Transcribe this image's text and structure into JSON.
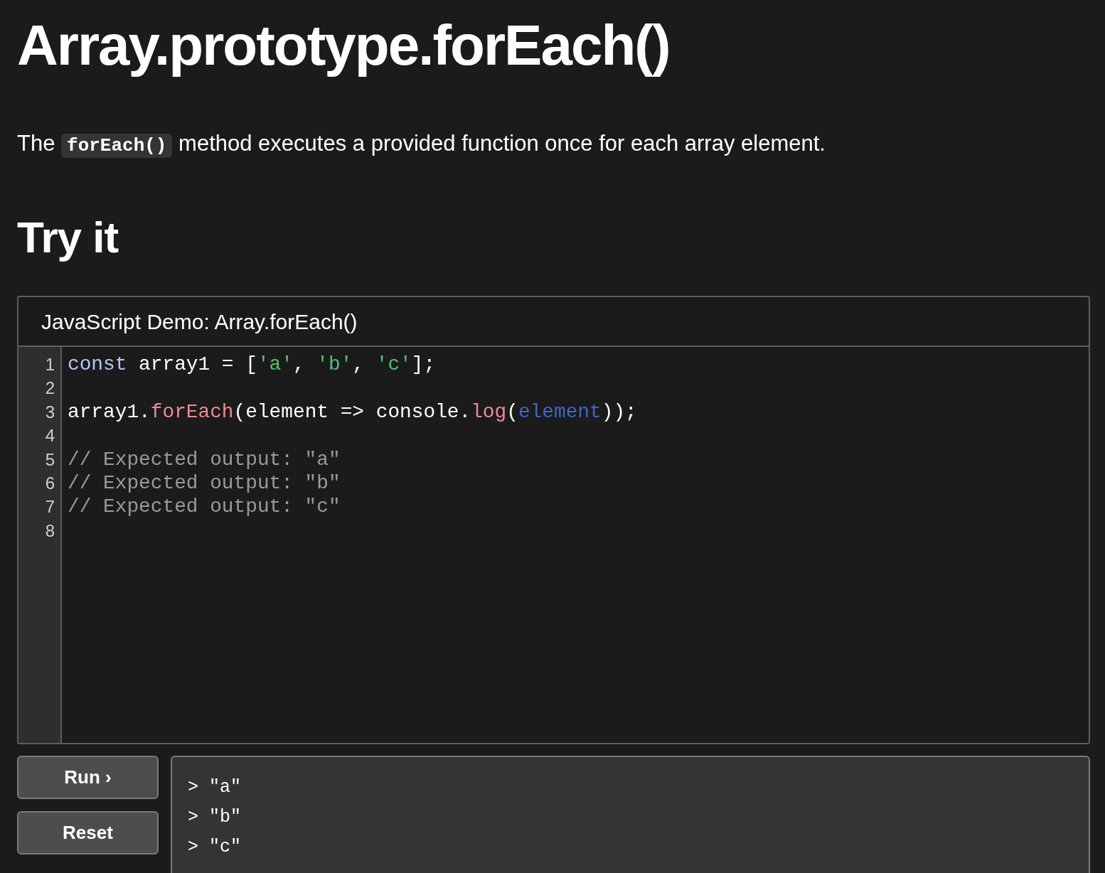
{
  "title": "Array.prototype.forEach()",
  "description": {
    "before": "The",
    "code": "forEach()",
    "after": "method executes a provided function once for each array element."
  },
  "section_heading": "Try it",
  "demo": {
    "title": "JavaScript Demo: Array.forEach()",
    "lines": [
      {
        "number": "1",
        "tokens": [
          {
            "kind": "keyword",
            "text": "const"
          },
          {
            "kind": "plain",
            "text": " array1 = ["
          },
          {
            "kind": "string",
            "text": "'a'"
          },
          {
            "kind": "plain",
            "text": ", "
          },
          {
            "kind": "string",
            "text": "'b'"
          },
          {
            "kind": "plain",
            "text": ", "
          },
          {
            "kind": "string",
            "text": "'c'"
          },
          {
            "kind": "plain",
            "text": "];"
          }
        ]
      },
      {
        "number": "2"
      },
      {
        "number": "3",
        "tokens": [
          {
            "kind": "plain",
            "text": "array1."
          },
          {
            "kind": "method",
            "text": "forEach"
          },
          {
            "kind": "plain",
            "text": "(element => console."
          },
          {
            "kind": "method",
            "text": "log"
          },
          {
            "kind": "plain",
            "text": "("
          },
          {
            "kind": "variable",
            "text": "element"
          },
          {
            "kind": "plain",
            "text": "));"
          }
        ]
      },
      {
        "number": "4"
      },
      {
        "number": "5",
        "tokens": [
          {
            "kind": "comment",
            "text": "// Expected output: \"a\""
          }
        ]
      },
      {
        "number": "6",
        "tokens": [
          {
            "kind": "comment",
            "text": "// Expected output: \"b\""
          }
        ]
      },
      {
        "number": "7",
        "tokens": [
          {
            "kind": "comment",
            "text": "// Expected output: \"c\""
          }
        ]
      },
      {
        "number": "8"
      }
    ],
    "buttons": [
      "Run ›",
      "Reset"
    ],
    "output": [
      "> \"a\"",
      "> \"b\"",
      "> \"c\""
    ]
  }
}
